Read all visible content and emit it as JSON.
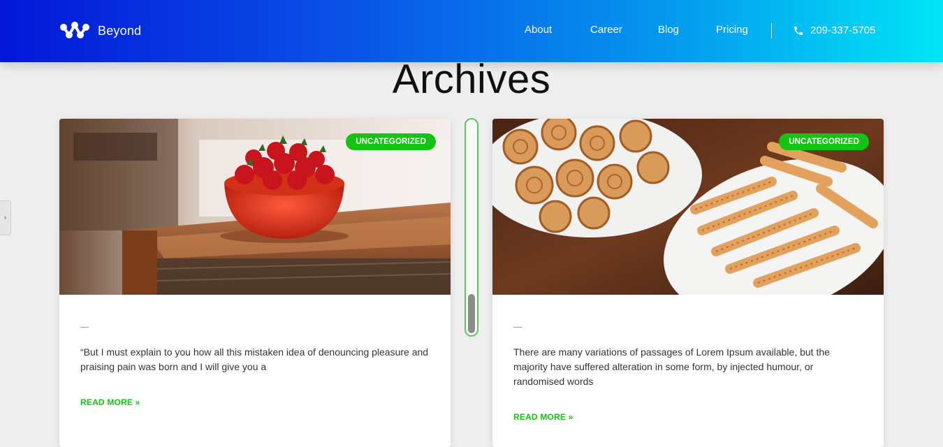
{
  "header": {
    "brand": "Beyond",
    "nav": [
      {
        "label": "About"
      },
      {
        "label": "Career"
      },
      {
        "label": "Blog"
      },
      {
        "label": "Pricing"
      }
    ],
    "phone": "209-337-5705"
  },
  "page": {
    "title": "Archives"
  },
  "posts": [
    {
      "category": "UNCATEGORIZED",
      "excerpt": "“But I must explain to you how all this mistaken idea of denouncing pleasure and praising pain was born and I will give you a",
      "read_more": "READ MORE »",
      "image_icon": "strawberries-bowl-photo"
    },
    {
      "category": "UNCATEGORIZED",
      "excerpt": "There are many variations of passages of Lorem Ipsum available, but the majority have suffered alteration in some form, by injected humour, or randomised words",
      "read_more": "READ MORE »",
      "image_icon": "pastries-platter-photo"
    }
  ],
  "colors": {
    "accent": "#13c413",
    "header_start": "#0317d8",
    "header_end": "#00e5f5",
    "background": "#eeeeee"
  },
  "side_tab_icon": "chevron-right-icon"
}
